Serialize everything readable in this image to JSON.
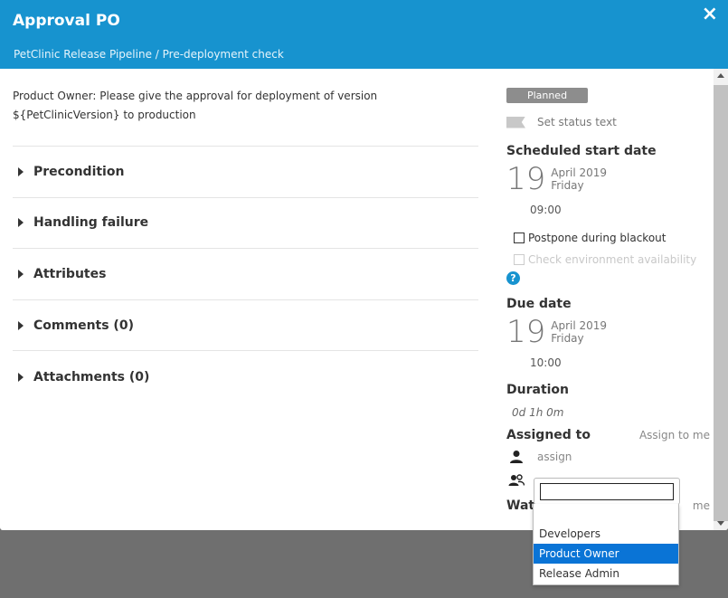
{
  "header": {
    "title": "Approval PO",
    "subtitle": "PetClinic Release Pipeline / Pre-deployment check",
    "close_icon": "×"
  },
  "description": "Product Owner: Please give the approval for deployment of version ${PetClinicVersion} to production",
  "sections": [
    {
      "label": "Precondition"
    },
    {
      "label": "Handling failure"
    },
    {
      "label": "Attributes"
    },
    {
      "label": "Comments (0)"
    },
    {
      "label": "Attachments (0)"
    }
  ],
  "status": {
    "badge": "Planned",
    "set_status_text": "Set status text",
    "badge_color": "#8d8d8d"
  },
  "scheduled_start": {
    "heading": "Scheduled start date",
    "day": "19",
    "month_year": "April 2019",
    "weekday": "Friday",
    "time": "09:00"
  },
  "options": {
    "postpone": "Postpone during blackout",
    "check_env": "Check environment availability",
    "help_icon": "?"
  },
  "due_date": {
    "heading": "Due date",
    "day": "19",
    "month_year": "April 2019",
    "weekday": "Friday",
    "time": "10:00"
  },
  "duration": {
    "heading": "Duration",
    "value": "0d 1h 0m"
  },
  "assigned": {
    "heading": "Assigned to",
    "assign_to_me": "Assign to me",
    "assign_link": "assign"
  },
  "watchers": {
    "heading_partial": "Wat",
    "assign_partial": "me"
  },
  "team_dropdown": {
    "options": [
      "",
      "Developers",
      "Product Owner",
      "Release Admin"
    ],
    "selected": "Product Owner"
  },
  "colors": {
    "header": "#1793cf",
    "selected_option": "#0a74d6",
    "overlay": "#6f6f6f"
  }
}
